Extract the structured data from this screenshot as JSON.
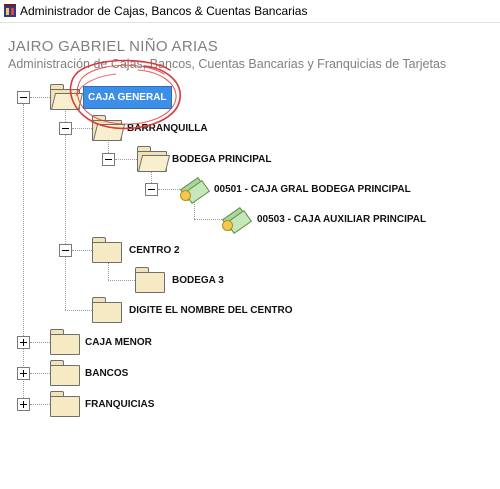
{
  "window": {
    "title": "Administrador de Cajas, Bancos & Cuentas Bancarias",
    "icon": "app-icon"
  },
  "header": {
    "user_name": "JAIRO GABRIEL NIÑO ARIAS",
    "subtitle": "Administración de Cajas, Bancos, Cuentas Bancarias y Franquicias de Tarjetas"
  },
  "colors": {
    "selection": "#3d8ee6",
    "annotation": "#d93a3a",
    "folder": "#f6eac4"
  },
  "tree": [
    {
      "id": "caja-general",
      "label": "CAJA GENERAL",
      "icon": "folder-open-icon",
      "expander": "collapse",
      "selected": true
    },
    {
      "id": "barranquilla",
      "label": "BARRANQUILLA",
      "icon": "folder-open-icon",
      "expander": "collapse"
    },
    {
      "id": "bodega-principal",
      "label": "BODEGA PRINCIPAL",
      "icon": "folder-open-icon",
      "expander": "collapse"
    },
    {
      "id": "caja-00501",
      "label": "00501 - CAJA GRAL BODEGA PRINCIPAL",
      "icon": "money-icon",
      "expander": "collapse"
    },
    {
      "id": "caja-00503",
      "label": "00503 - CAJA AUXILIAR PRINCIPAL",
      "icon": "money-icon",
      "expander": "none"
    },
    {
      "id": "centro-2",
      "label": "CENTRO 2",
      "icon": "folder-icon",
      "expander": "collapse"
    },
    {
      "id": "bodega-3",
      "label": "BODEGA 3",
      "icon": "folder-icon",
      "expander": "none"
    },
    {
      "id": "digite-centro",
      "label": "DIGITE EL NOMBRE DEL CENTRO",
      "icon": "folder-icon",
      "expander": "none"
    },
    {
      "id": "caja-menor",
      "label": "CAJA MENOR",
      "icon": "folder-icon",
      "expander": "expand"
    },
    {
      "id": "bancos",
      "label": "BANCOS",
      "icon": "folder-icon",
      "expander": "expand"
    },
    {
      "id": "franquicias",
      "label": "FRANQUICIAS",
      "icon": "folder-icon",
      "expander": "expand"
    }
  ]
}
